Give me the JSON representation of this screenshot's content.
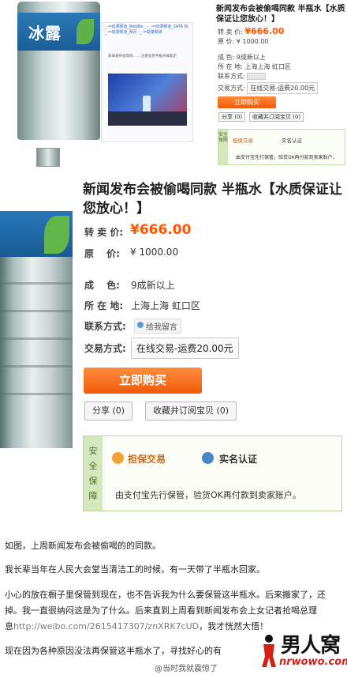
{
  "top_listing": {
    "title": "新闻发布会被偷喝同款 半瓶水【水质保证让您放心！】",
    "price_label": "转 卖 价:",
    "price": "¥666.00",
    "original_label": "原 价:",
    "original_price": "¥ 1000.00",
    "condition_label": "成 色:",
    "condition": "9成新以上",
    "location_label": "所 在 地:",
    "location": "上海上海 虹口区",
    "contact_label": "联系方式:",
    "trade_label": "交易方式:",
    "trade": "在线交易-运费20.00元",
    "buy_button": "立即购买",
    "share_button": "分享 (0)",
    "favorite_button": "收藏并订阅宝贝 (0)",
    "guarantee_side": "安全保障",
    "guarantee_escrow": "担保交易",
    "guarantee_verified": "实名认证",
    "guarantee_note": "由支付宝先行保管，验货OK再付款到卖家账户。"
  },
  "main_listing": {
    "title": "新闻发布会被偷喝同款 半瓶水【水质保证让您放心！】",
    "price_label": "转 卖 价:",
    "price": "¥666.00",
    "original_label": "原　 价:",
    "original_price": "¥ 1000.00",
    "condition_label": "成　 色:",
    "condition": "9成新以上",
    "location_label": "所 在 地:",
    "location": "上海上海 虹口区",
    "contact_label": "联系方式:",
    "contact": "给我留言",
    "trade_label": "交易方式:",
    "trade": "在线交易-运费20.00元",
    "buy_button": "立即购买",
    "share_button": "分享 (0)",
    "favorite_button": "收藏并订阅宝贝 (0)",
    "guarantee_side": "安全保障",
    "guarantee_escrow": "担保交易",
    "guarantee_verified": "实名认证",
    "guarantee_note": "由支付宝先行保管，验货OK再付款到卖家账户。"
  },
  "description": {
    "p1": "如图，上周新闻发布会被偷喝的的同款。",
    "p2": "我长辈当年在人民大会堂当清洁工的时候，有一天带了半瓶水回家。",
    "p3a": "小心的放在橱子里保管到现在，也不告诉我为什么要保管这半瓶水。后来搬家了，还",
    "p3b": "掉。我一直很纳闷这是为了什么。后来直到上周看到新闻发布会上女记者抢喝总理",
    "p3c_prefix": "息",
    "p3c_link": "http://weibo.com/2615417307/znXRK7cUD",
    "p3c_suffix": "，我才恍然大悟！",
    "p4": "现在因为各种原因没法再保管这半瓶水了，寻找好心的有"
  },
  "watermark": "@当时我就震惊了",
  "logo": {
    "cn": "男人窝",
    "en": "nrwowo.com"
  },
  "colors": {
    "price": "#ff5500",
    "buy_button": "#f25a09",
    "guarantee_border": "#bcd79c"
  }
}
